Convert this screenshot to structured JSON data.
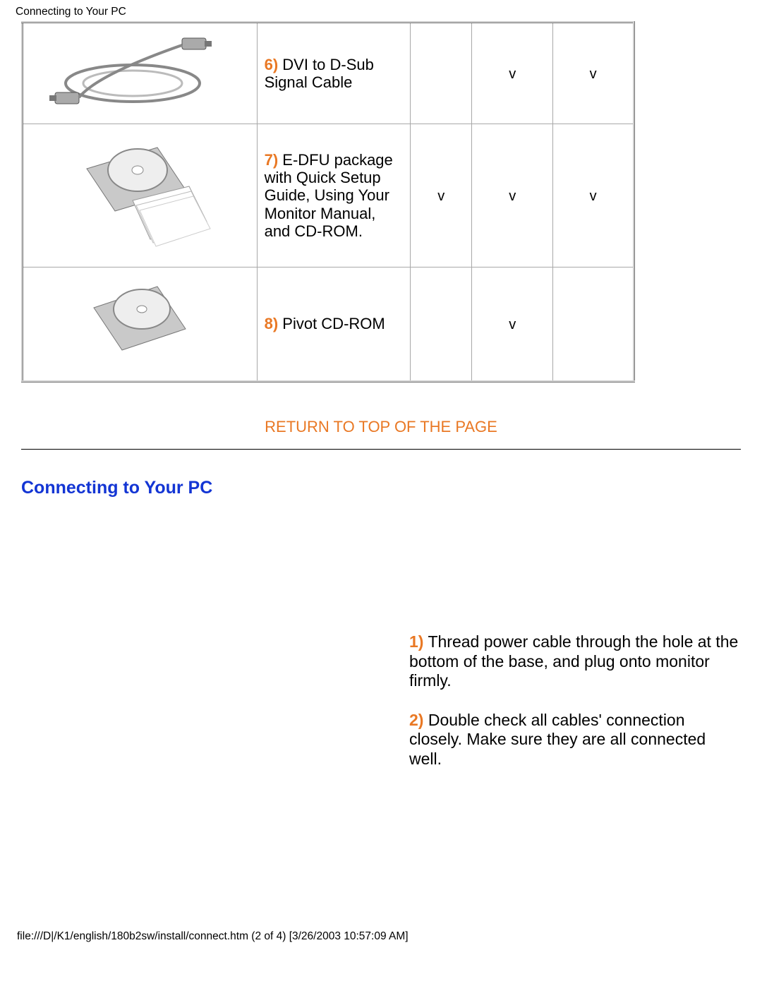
{
  "header_title": "Connecting to Your PC",
  "table": {
    "rows": [
      {
        "num": "6)",
        "desc": "DVI to D-Sub Signal Cable",
        "c1": "",
        "c2": "v",
        "c3": "v"
      },
      {
        "num": "7)",
        "desc": "E-DFU package with Quick Setup Guide, Using Your Monitor Manual, and CD-ROM.",
        "c1": "v",
        "c2": "v",
        "c3": "v"
      },
      {
        "num": "8)",
        "desc": "Pivot CD-ROM",
        "c1": "",
        "c2": "v",
        "c3": ""
      }
    ]
  },
  "return_link": "RETURN TO TOP OF THE PAGE",
  "section_heading": "Connecting to Your PC",
  "steps": [
    {
      "num": "1)",
      "text": "Thread power cable through the hole at the bottom of the base, and plug onto monitor firmly."
    },
    {
      "num": "2)",
      "text": "Double check all cables' connection closely. Make sure they are all connected well."
    }
  ],
  "footer": "file:///D|/K1/english/180b2sw/install/connect.htm (2 of 4) [3/26/2003 10:57:09 AM]"
}
